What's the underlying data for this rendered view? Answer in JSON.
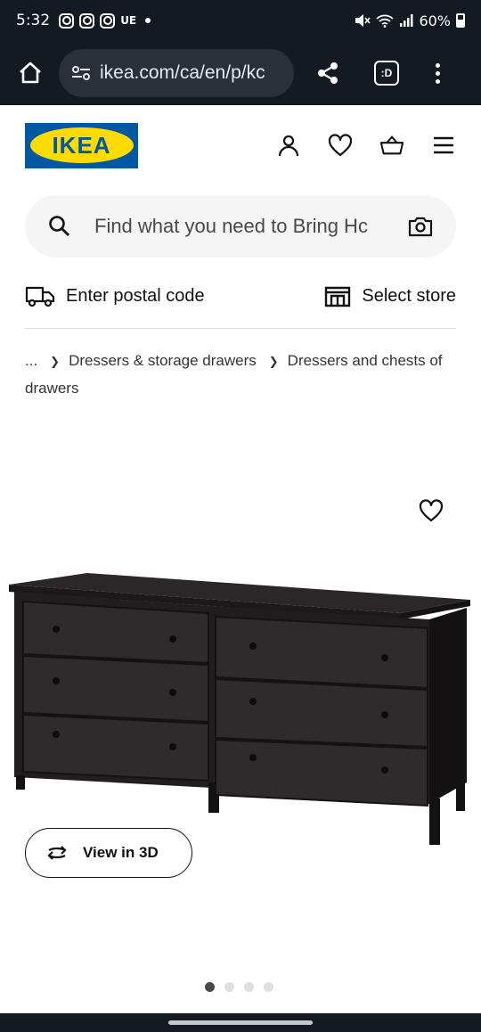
{
  "status": {
    "time": "5:32",
    "carrier_text": "UE",
    "battery": "60%"
  },
  "browser": {
    "url": "ikea.com/ca/en/p/kc",
    "tab_label": ":D",
    "icons": [
      "home-icon",
      "tune-icon",
      "share-icon",
      "tab-switcher-icon",
      "more-vert-icon"
    ]
  },
  "header": {
    "logo_text": "IKEA",
    "brand_colors": {
      "blue": "#0058a3",
      "yellow": "#ffdb00"
    },
    "icons": [
      "account-icon",
      "favourites-icon",
      "cart-icon",
      "hamburger-menu-icon"
    ]
  },
  "search": {
    "placeholder": "Find what you need to Bring Hc"
  },
  "location": {
    "postal_label": "Enter postal code",
    "store_label": "Select store"
  },
  "breadcrumb": {
    "ellipsis": "...",
    "items": [
      "Dressers & storage drawers",
      "Dressers and chests of drawers"
    ]
  },
  "gallery": {
    "view_3d_label": "View in 3D",
    "image_count": 4,
    "active_index": 0
  }
}
